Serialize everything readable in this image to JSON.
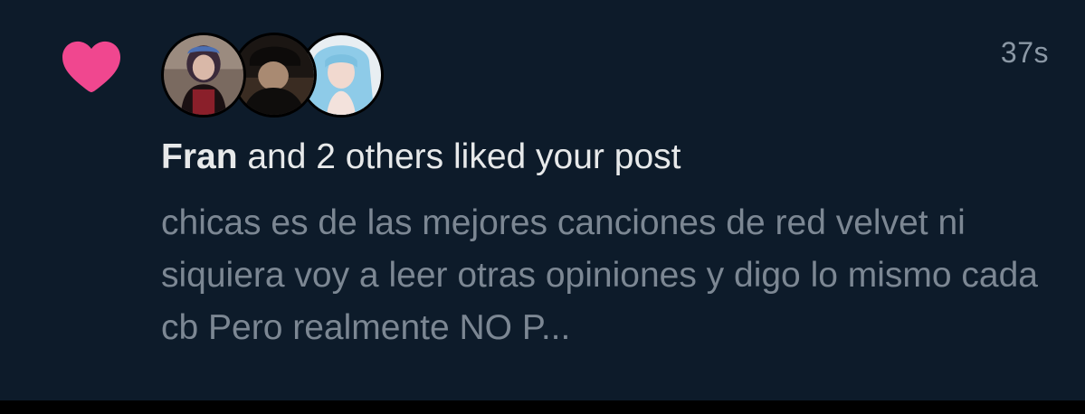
{
  "colors": {
    "background": "#0d1b2a",
    "heart": "#f0478f",
    "primary_text": "#e7e9ea",
    "secondary_text": "#7c8793"
  },
  "notification": {
    "type_icon": "heart-icon",
    "timestamp": "37s",
    "actor_name": "Fran",
    "title_rest": " and 2 others liked your post",
    "post_preview": "chicas es de las mejores canciones de red velvet ni siquiera voy a leer otras opiniones y digo lo mismo cada cb Pero realmente NO P..."
  }
}
